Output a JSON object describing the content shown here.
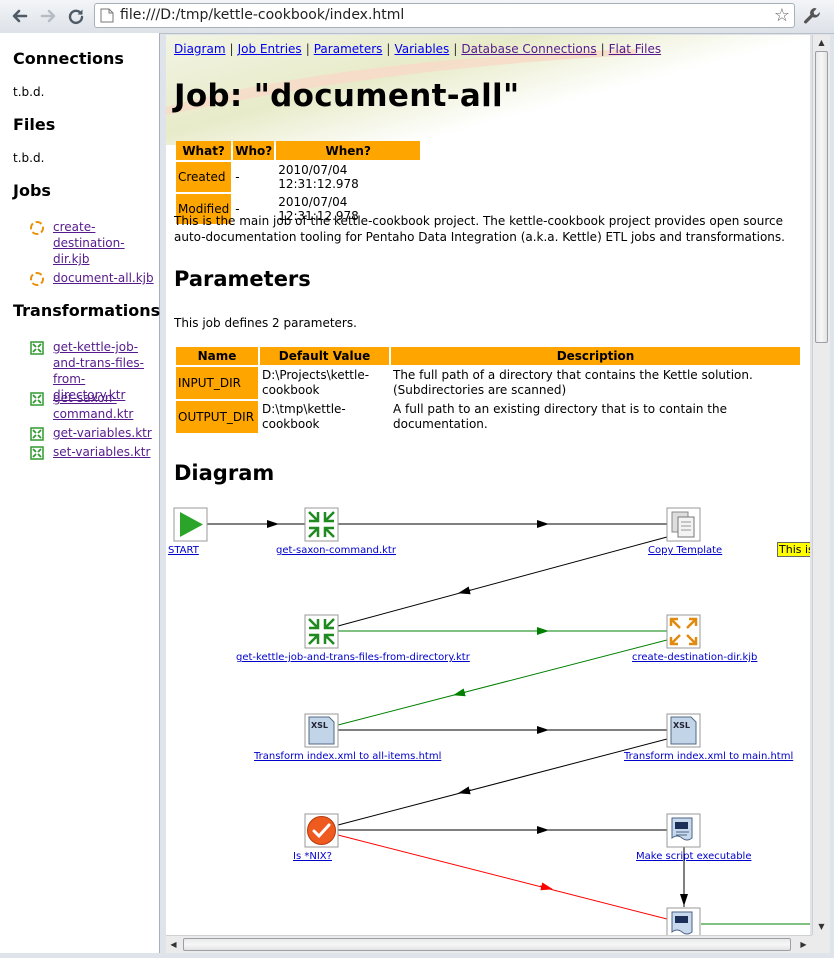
{
  "browser": {
    "url": "file:///D:/tmp/kettle-cookbook/index.html"
  },
  "sidebar": {
    "connections_heading": "Connections",
    "connections_value": "t.b.d.",
    "files_heading": "Files",
    "files_value": "t.b.d.",
    "jobs_heading": "Jobs",
    "jobs": [
      "create-destination-dir.kjb",
      "document-all.kjb"
    ],
    "transformations_heading": "Transformations",
    "transformations": [
      "get-kettle-job-and-trans-files-from-directory.ktr",
      "get-saxon-command.ktr",
      "get-variables.ktr",
      "set-variables.ktr"
    ]
  },
  "topnav": [
    "Diagram",
    "Job Entries",
    "Parameters",
    "Variables",
    "Database Connections",
    "Flat Files"
  ],
  "page": {
    "title": "Job: \"document-all\"",
    "meta_headers": [
      "What?",
      "Who?",
      "When?"
    ],
    "meta_rows": [
      {
        "what": "Created",
        "who": "-",
        "when": "2010/07/04 12:31:12.978"
      },
      {
        "what": "Modified",
        "who": "-",
        "when": "2010/07/04 12:31:12.978"
      }
    ],
    "description": "This is the main job of the kettle-cookbook project. The kettle-cookbook project provides open source auto-documentation tooling for Pentaho Data Integration (a.k.a. Kettle) ETL jobs and transformations.",
    "parameters_heading": "Parameters",
    "parameters_intro": "This job defines 2 parameters.",
    "param_headers": [
      "Name",
      "Default Value",
      "Description"
    ],
    "param_rows": [
      {
        "name": "INPUT_DIR",
        "default": "D:\\Projects\\kettle-cookbook",
        "desc": "The full path of a directory that contains the Kettle solution. (Subdirectories are scanned)"
      },
      {
        "name": "OUTPUT_DIR",
        "default": "D:\\tmp\\kettle-cookbook",
        "desc": "A full path to an existing directory that is to contain the documentation."
      }
    ],
    "diagram_heading": "Diagram",
    "note_text": "This is t"
  },
  "diagram_nodes": [
    {
      "label": "START",
      "icon": "start-icon"
    },
    {
      "label": "get-saxon-command.ktr",
      "icon": "transformation-icon"
    },
    {
      "label": "Copy Template",
      "icon": "copy-files-icon"
    },
    {
      "label": "get-kettle-job-and-trans-files-from-directory.ktr",
      "icon": "transformation-icon"
    },
    {
      "label": "create-destination-dir.kjb",
      "icon": "job-icon"
    },
    {
      "label": "Transform index.xml to all-items.html",
      "icon": "xsl-icon"
    },
    {
      "label": "Transform index.xml to main.html",
      "icon": "xsl-icon"
    },
    {
      "label": "Is *NIX?",
      "icon": "condition-icon"
    },
    {
      "label": "Make script executable",
      "icon": "shell-script-icon"
    },
    {
      "label": "",
      "icon": "shell-script-icon"
    }
  ],
  "colors": {
    "accent": "#ffa500",
    "link": "#0000ee",
    "visited": "#551a8b",
    "hop_unconditional": "#000000",
    "hop_success": "#008000",
    "hop_failure": "#ff0000",
    "note": "#ffff00"
  }
}
